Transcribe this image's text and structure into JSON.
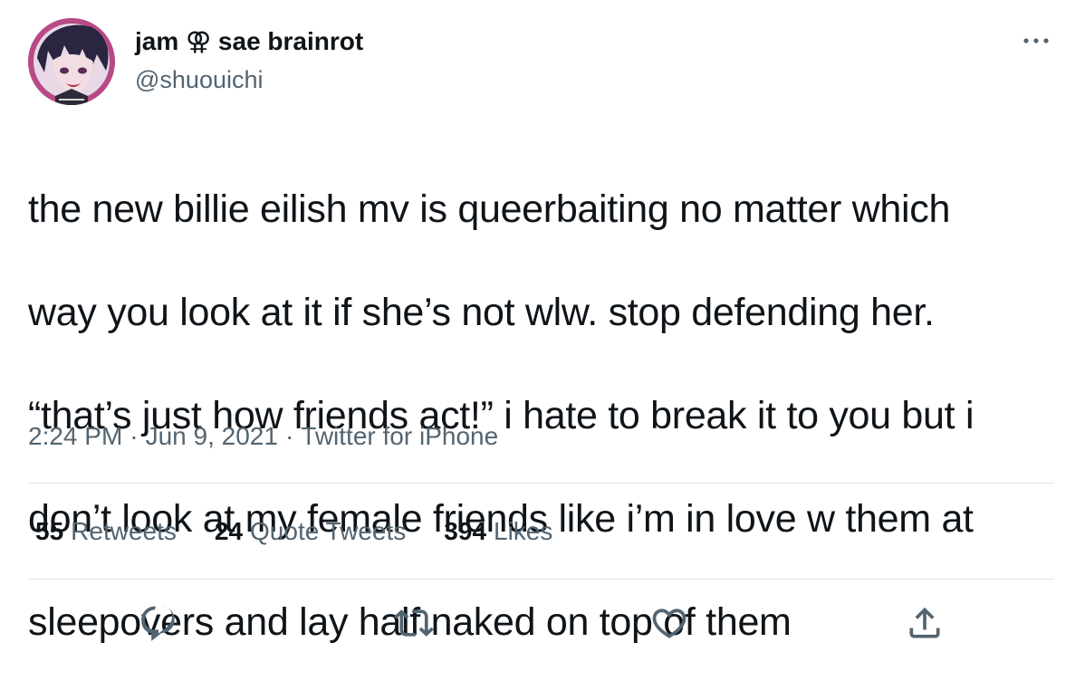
{
  "user": {
    "display_name": "jam ⚢ sae brainrot",
    "handle": "@shuouichi",
    "avatar_icon": "profile-avatar"
  },
  "tweet": {
    "lines": [
      "the new billie eilish mv is queerbaiting no matter which",
      "way you look at it if she’s not wlw. stop defending her.",
      "“that’s just how friends act!” i hate to break it to you but i",
      "don’t look at my female friends like i’m in love w them at",
      "sleepovers and lay half naked on top of them"
    ]
  },
  "meta": {
    "time": "2:24 PM",
    "date": "Jun 9, 2021",
    "source": "Twitter for iPhone",
    "separator": "·"
  },
  "stats": {
    "retweets_count": "55",
    "retweets_label": "Retweets",
    "quotes_count": "24",
    "quotes_label": "Quote Tweets",
    "likes_count": "394",
    "likes_label": "Likes"
  },
  "actions": {
    "reply_icon": "reply-icon",
    "retweet_icon": "retweet-icon",
    "like_icon": "heart-icon",
    "share_icon": "share-icon",
    "more_icon": "more-icon"
  },
  "colors": {
    "text_primary": "#0f1419",
    "text_secondary": "#536471",
    "divider": "#e1e5e8",
    "avatar_ring": "#b84a86"
  }
}
